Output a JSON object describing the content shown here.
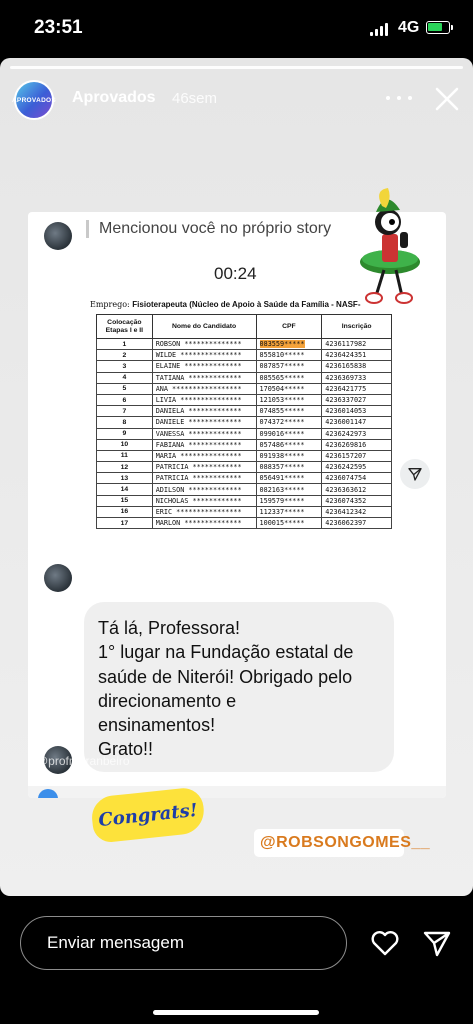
{
  "status_bar": {
    "time": "23:51",
    "network": "4G",
    "battery_color": "#2bd45a"
  },
  "story": {
    "account": {
      "avatar_text": "APROVADOS",
      "name": "Aprovados",
      "age": "46sem"
    },
    "icons": {
      "more": "more-dots-icon",
      "close": "close-icon"
    },
    "screenshot": {
      "mention_text": "Mencionou você no próprio story",
      "timer": "00:24",
      "document": {
        "employment_label": "Emprego:",
        "employment_value": "Fisioterapeuta (Núcleo de Apoio à Saúde da Família - NASF-",
        "columns": [
          "Colocação Etapas I e II",
          "Nome do Candidato",
          "CPF",
          "Inscrição"
        ],
        "rows": [
          [
            "1",
            "ROBSON **************",
            "083559*****",
            "4236117982"
          ],
          [
            "2",
            "WILDE ***************",
            "855810*****",
            "4236424351"
          ],
          [
            "3",
            "ELAINE **************",
            "087857*****",
            "4236165838"
          ],
          [
            "4",
            "TATIANA *************",
            "085565*****",
            "4236369733"
          ],
          [
            "5",
            "ANA *****************",
            "170504*****",
            "4236421775"
          ],
          [
            "6",
            "LIVIA ***************",
            "121053*****",
            "4236337027"
          ],
          [
            "7",
            "DANIELA *************",
            "074855*****",
            "4236014053"
          ],
          [
            "8",
            "DANIELE *************",
            "074372*****",
            "4236001147"
          ],
          [
            "9",
            "VANESSA *************",
            "099016*****",
            "4236242973"
          ],
          [
            "10",
            "FABIANA *************",
            "057486*****",
            "4236269816"
          ],
          [
            "11",
            "MARIA ***************",
            "091938*****",
            "4236157207"
          ],
          [
            "12",
            "PATRICIA ************",
            "088357*****",
            "4236242595"
          ],
          [
            "13",
            "PATRICIA ************",
            "056491*****",
            "4236074754"
          ],
          [
            "14",
            "ADILSON *************",
            "082163*****",
            "4236363612"
          ],
          [
            "15",
            "NICHOLAS ************",
            "159579*****",
            "4236074352"
          ],
          [
            "16",
            "ERIC ****************",
            "112337*****",
            "4236412342"
          ],
          [
            "17",
            "MARLON **************",
            "100015*****",
            "4236062397"
          ]
        ],
        "highlight_color": "#f4a23a"
      },
      "message_lines": [
        "Tá lá, Professora!",
        "1° lugar na Fundação estatal de",
        "saúde de Niterói! Obrigado pelo",
        "direcionamento e",
        "ensinamentos!",
        "Grato!!"
      ]
    },
    "mention_tag": "@profmaranbeiro",
    "congrats_sticker": "Congrats!",
    "handle_tag": "@ROBSONGOMES__"
  },
  "reply_bar": {
    "placeholder": "Enviar mensagem",
    "like_icon": "heart-icon",
    "send_icon": "send-icon"
  }
}
